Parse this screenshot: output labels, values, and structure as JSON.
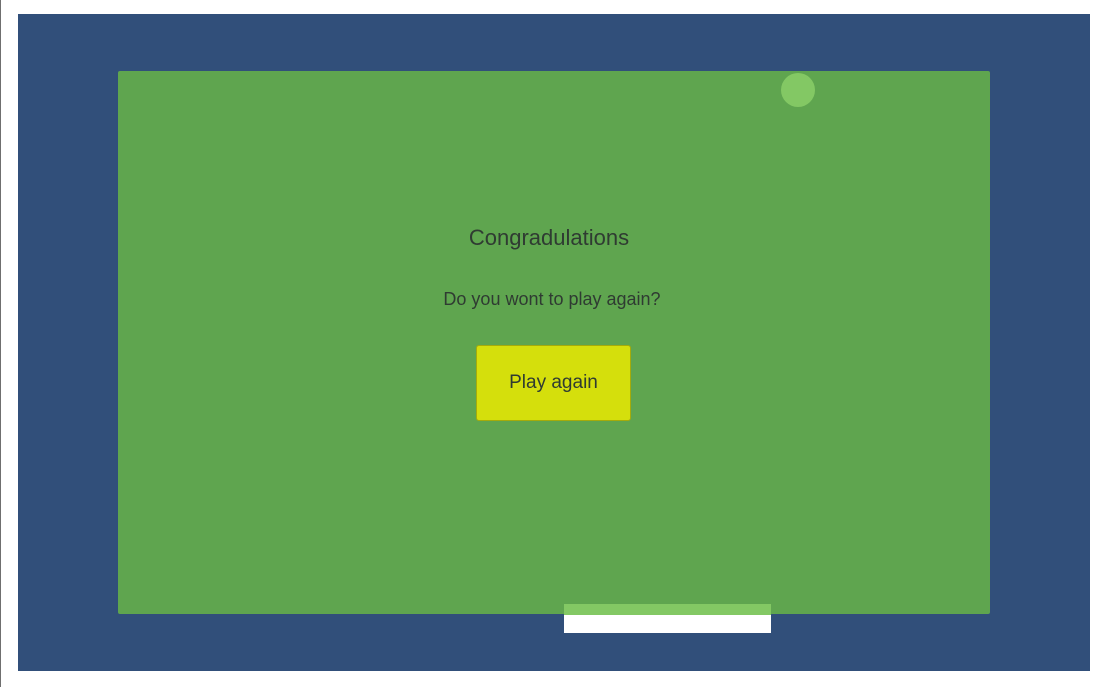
{
  "screen": {
    "background_color": "#314f7a",
    "field_color": "#5fa54f",
    "ball_color": "#83c864",
    "button_color": "#d5df0c",
    "paddle_top_color": "#83c864",
    "paddle_bottom_color": "#ffffff"
  },
  "dialog": {
    "title": "Congradulations",
    "question": "Do you wont to play again?",
    "play_again_label": "Play again"
  }
}
